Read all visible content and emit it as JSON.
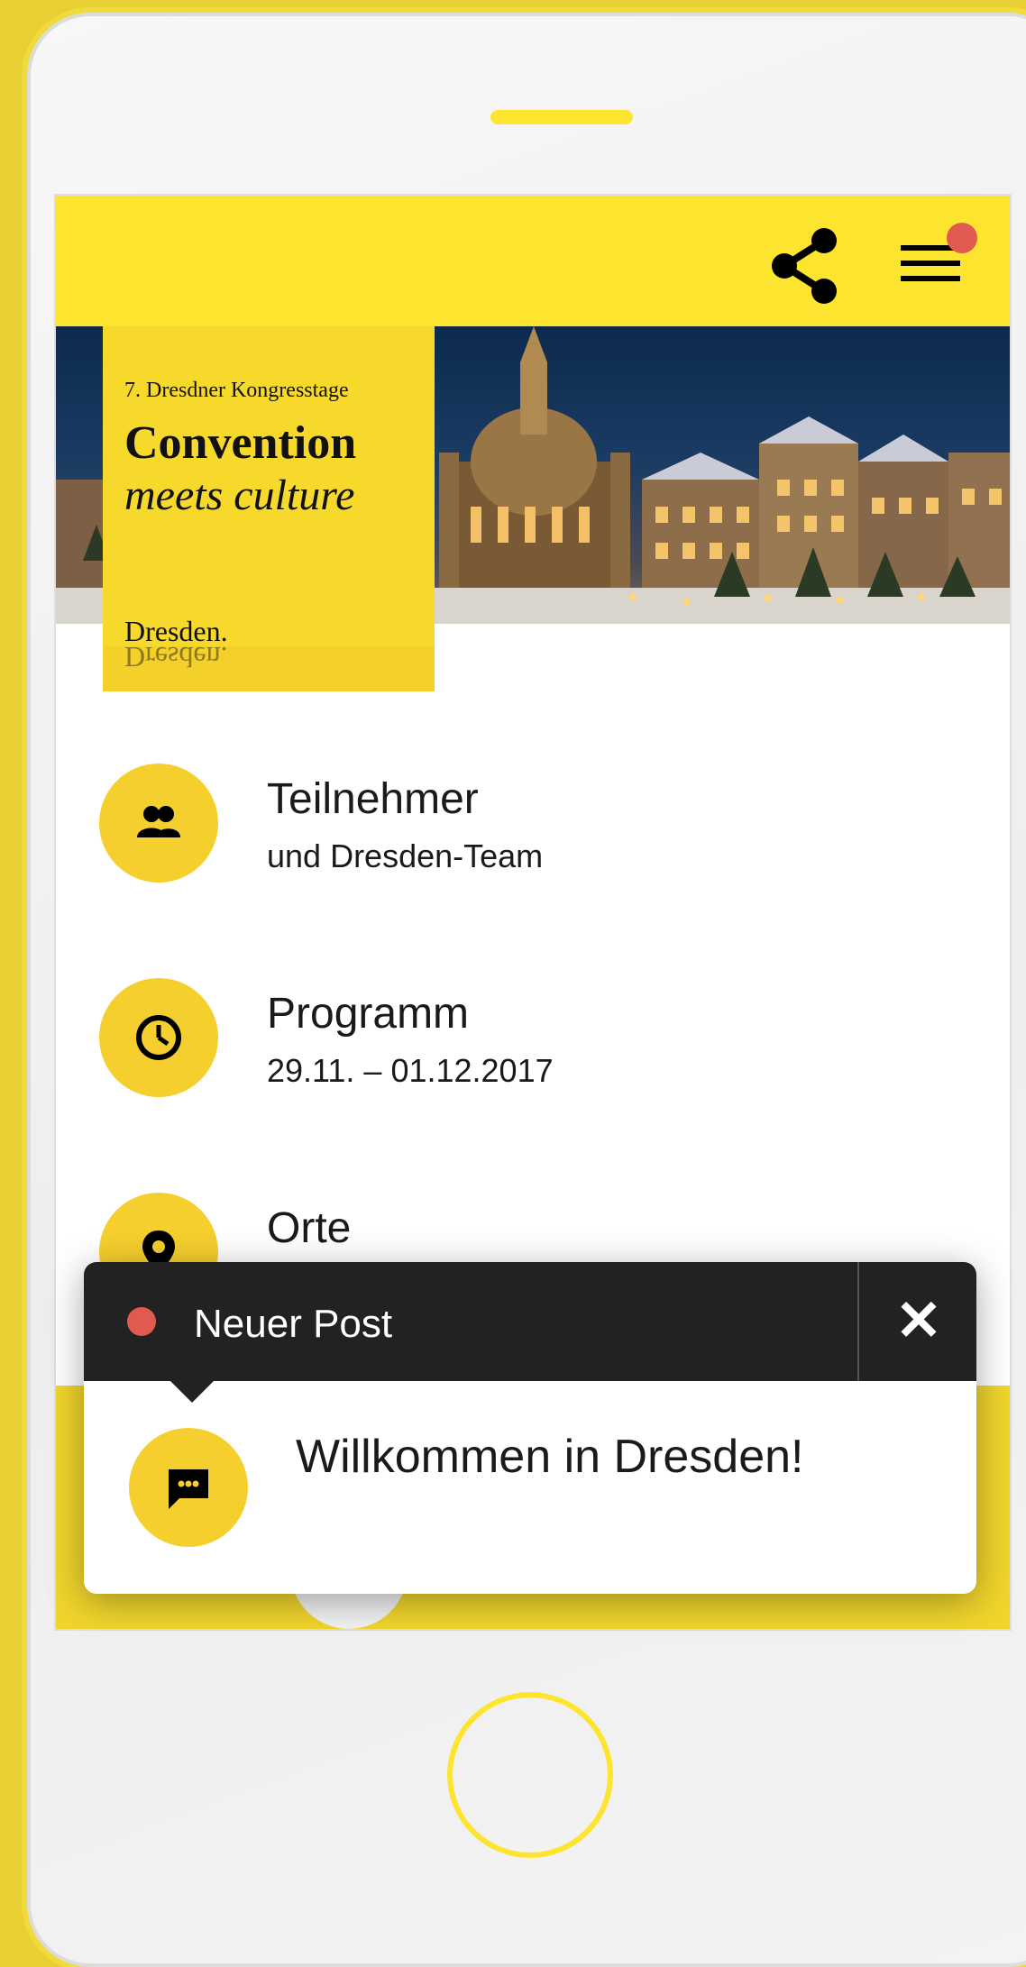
{
  "header": {
    "share_icon": "share-icon",
    "menu_icon": "hamburger-menu-icon",
    "notification_color": "#e05a4f",
    "background_color": "#fde52f"
  },
  "hero": {
    "kicker": "7. Dresdner Kongresstage",
    "title": "Convention",
    "subtitle": "meets culture",
    "city": "Dresden.",
    "badge_color": "#f7d92c"
  },
  "menu": {
    "items": [
      {
        "title": "Teilnehmer",
        "subtitle": "und Dresden-Team",
        "icon": "people-icon"
      },
      {
        "title": "Programm",
        "subtitle": "29.11. – 01.12.2017",
        "icon": "clock-icon"
      },
      {
        "title": "Orte",
        "subtitle": "",
        "icon": "location-icon"
      }
    ]
  },
  "notification": {
    "title": "Neuer Post",
    "close_label": "✕",
    "message": "Willkommen in Dresden!",
    "icon": "chat-bubble-icon",
    "dot_color": "#e05a4f"
  },
  "colors": {
    "accent": "#f5cf2e",
    "dark": "#222222"
  }
}
